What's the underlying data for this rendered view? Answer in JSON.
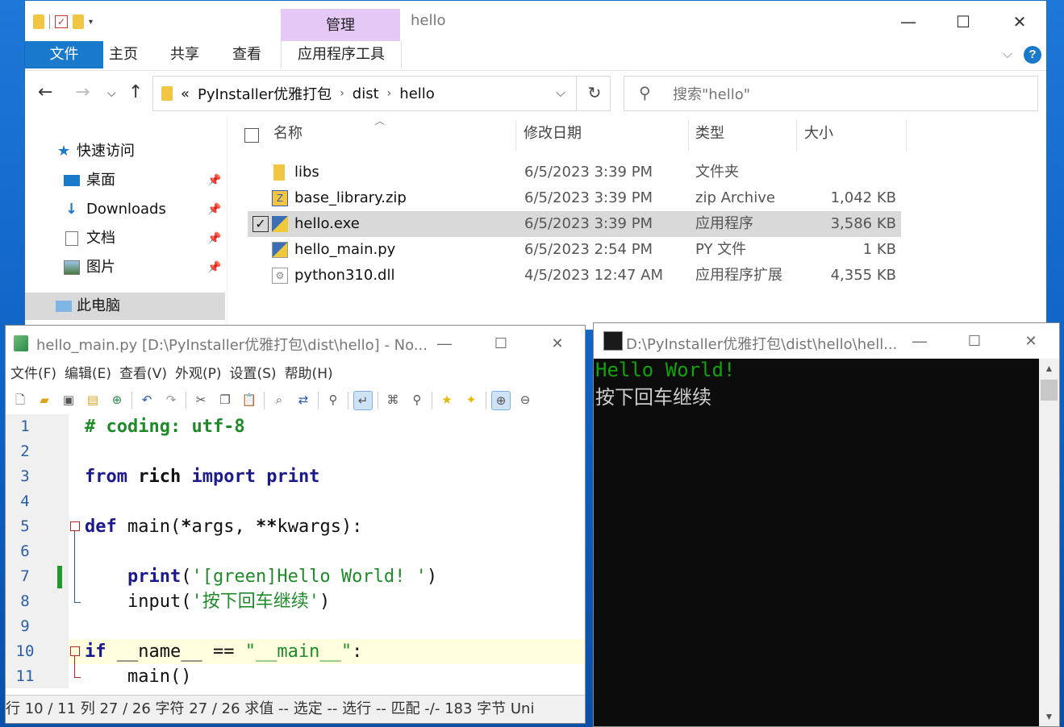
{
  "explorer": {
    "ribbon_context_tab": "管理",
    "window_title": "hello",
    "tabs": [
      "文件",
      "主页",
      "共享",
      "查看"
    ],
    "context_tool": "应用程序工具",
    "breadcrumb": [
      "«",
      "PyInstaller优雅打包",
      "dist",
      "hello"
    ],
    "search_placeholder": "搜索\"hello\"",
    "nav": [
      {
        "label": "快速访问",
        "icon": "star-icon"
      },
      {
        "label": "桌面",
        "icon": "desktop-icon",
        "pinned": true
      },
      {
        "label": "Downloads",
        "icon": "download-icon",
        "pinned": true
      },
      {
        "label": "文档",
        "icon": "document-icon",
        "pinned": true
      },
      {
        "label": "图片",
        "icon": "picture-icon",
        "pinned": true
      },
      {
        "label": "此电脑",
        "icon": "computer-icon",
        "selected": true
      }
    ],
    "columns": [
      "名称",
      "修改日期",
      "类型",
      "大小"
    ],
    "files": [
      {
        "name": "libs",
        "date": "6/5/2023 3:39 PM",
        "type": "文件夹",
        "size": "",
        "icon": "folder-icon"
      },
      {
        "name": "base_library.zip",
        "date": "6/5/2023 3:39 PM",
        "type": "zip Archive",
        "size": "1,042 KB",
        "icon": "zip-icon"
      },
      {
        "name": "hello.exe",
        "date": "6/5/2023 3:39 PM",
        "type": "应用程序",
        "size": "3,586 KB",
        "icon": "python-exe-icon",
        "selected": true
      },
      {
        "name": "hello_main.py",
        "date": "6/5/2023 2:54 PM",
        "type": "PY 文件",
        "size": "1 KB",
        "icon": "python-file-icon"
      },
      {
        "name": "python310.dll",
        "date": "4/5/2023 12:47 AM",
        "type": "应用程序扩展",
        "size": "4,355 KB",
        "icon": "dll-icon"
      }
    ]
  },
  "notepad": {
    "title": "hello_main.py [D:\\PyInstaller优雅打包\\dist\\hello] - No...",
    "menu": [
      "文件(F)",
      "编辑(E)",
      "查看(V)",
      "外观(P)",
      "设置(S)",
      "帮助(H)"
    ],
    "line_numbers": [
      "1",
      "2",
      "3",
      "4",
      "5",
      "6",
      "7",
      "8",
      "9",
      "10",
      "11"
    ],
    "status": "行  10 / 11  列  27 / 26  字符  27 / 26  求值  --  选定  --  选行  --  匹配  -/-  183 字节  Uni"
  },
  "console": {
    "title": "D:\\PyInstaller优雅打包\\dist\\hello\\hell...",
    "lines": [
      {
        "text": "Hello World!",
        "color": "#13a10e"
      },
      {
        "text": "按下回车继续",
        "color": "#cccccc"
      }
    ]
  }
}
